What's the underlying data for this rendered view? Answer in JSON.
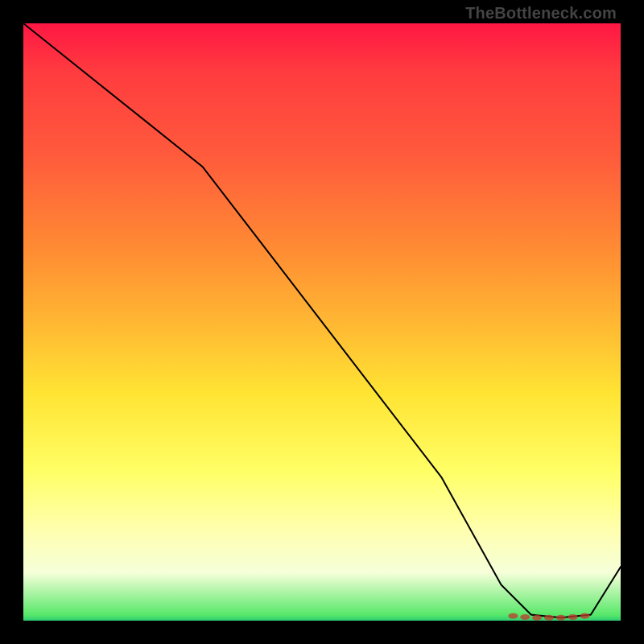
{
  "watermark": "TheBottleneck.com",
  "chart_data": {
    "type": "line",
    "title": "",
    "xlabel": "",
    "ylabel": "",
    "xlim": [
      0,
      100
    ],
    "ylim": [
      0,
      100
    ],
    "grid": false,
    "legend": false,
    "background": "rainbow-vertical-gradient",
    "annotations": [],
    "series": [
      {
        "name": "curve",
        "x": [
          0,
          10,
          20,
          30,
          40,
          50,
          60,
          70,
          80,
          85,
          90,
          95,
          100
        ],
        "y": [
          100,
          92,
          84,
          76,
          63,
          50,
          37,
          24,
          6,
          1,
          0.5,
          1,
          9
        ]
      }
    ],
    "optimal_cluster": {
      "x": [
        82,
        84,
        86,
        88,
        90,
        92,
        94
      ],
      "y": [
        0.8,
        0.6,
        0.5,
        0.5,
        0.5,
        0.6,
        0.8
      ]
    }
  }
}
